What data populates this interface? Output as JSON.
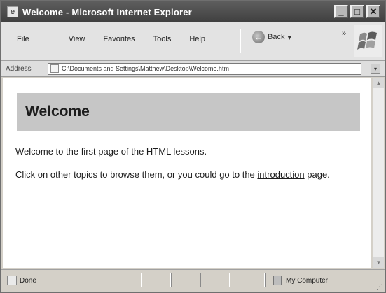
{
  "window": {
    "title": "Welcome - Microsoft Internet Explorer",
    "icon": "ie-page-icon"
  },
  "title_buttons": [
    {
      "name": "minimize-button",
      "icon": "minimize-icon",
      "glyph": "_"
    },
    {
      "name": "maximize-button",
      "icon": "maximize-icon",
      "glyph": "□"
    },
    {
      "name": "close-button",
      "icon": "close-icon",
      "glyph": "✕"
    }
  ],
  "menu": {
    "items": [
      "File",
      "View",
      "Favorites",
      "Tools",
      "Help"
    ],
    "back_label": "Back",
    "back_arrow": "←",
    "more_chevron": "»"
  },
  "address": {
    "label": "Address",
    "url": "C:\\Documents and Settings\\Matthew\\Desktop\\Welcome.htm",
    "dropdown_glyph": "▾"
  },
  "content": {
    "heading": "Welcome",
    "paragraph1": "Welcome to the first page of the HTML lessons.",
    "paragraph2_before": "Click on other topics to browse them, or you could go to the",
    "link_text": "introduction",
    "paragraph2_after": "page."
  },
  "scrollbar": {
    "up_glyph": "▲",
    "down_glyph": "▼"
  },
  "status": {
    "text": "Done",
    "zone": "My Computer",
    "grip": "⋰"
  },
  "colors": {
    "title_bar": "#4a4a4a",
    "heading_bg": "#c6c6c6",
    "chrome": "#d4d0c8"
  }
}
